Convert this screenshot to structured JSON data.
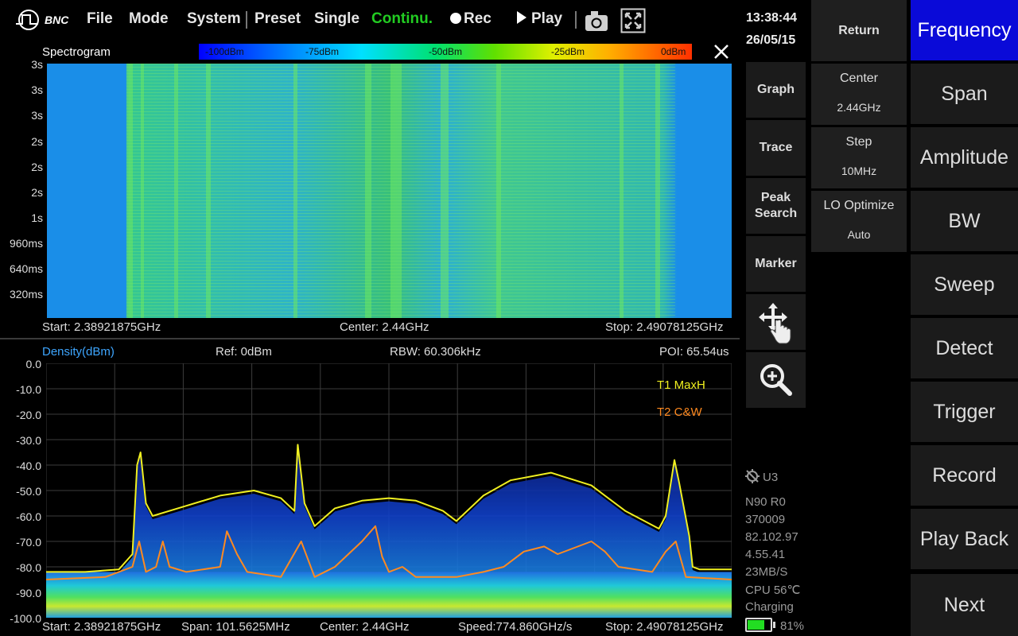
{
  "topbar": {
    "logo_text": "BNC",
    "menu": [
      "File",
      "Mode",
      "System",
      "Preset",
      "Single",
      "Continu.",
      "Rec",
      "Play"
    ],
    "active_color": "#22cc22"
  },
  "spectrogram": {
    "title": "Spectrogram",
    "colorbar_labels": [
      "-100dBm",
      "-75dBm",
      "-50dBm",
      "-25dBm",
      "0dBm"
    ],
    "time_ticks": [
      "3s",
      "3s",
      "3s",
      "2s",
      "2s",
      "2s",
      "1s",
      "960ms",
      "640ms",
      "320ms"
    ],
    "start": "Start: 2.38921875GHz",
    "center": "Center: 2.44GHz",
    "stop": "Stop: 2.49078125GHz"
  },
  "chart_data": {
    "type": "line",
    "title": "Density(dBm)",
    "ylim": [
      -100,
      0
    ],
    "ytick_labels": [
      "0.0",
      "-10.0",
      "-20.0",
      "-30.0",
      "-40.0",
      "-50.0",
      "-60.0",
      "-70.0",
      "-80.0",
      "-90.0",
      "-100.0"
    ],
    "xlim": [
      2.38921875,
      2.49078125
    ],
    "x_unit": "GHz",
    "grid": true,
    "header": {
      "ref": "Ref: 0dBm",
      "rbw": "RBW: 60.306kHz",
      "poi": "POI: 65.54us"
    },
    "series": [
      {
        "name": "T1 MaxH",
        "color": "#f0f020",
        "x": [
          2.3892,
          2.395,
          2.4,
          2.402,
          2.4027,
          2.4032,
          2.404,
          2.405,
          2.41,
          2.415,
          2.42,
          2.424,
          2.426,
          2.4265,
          2.4275,
          2.429,
          2.432,
          2.436,
          2.44,
          2.444,
          2.448,
          2.45,
          2.454,
          2.458,
          2.464,
          2.47,
          2.475,
          2.48,
          2.481,
          2.4823,
          2.483,
          2.4845,
          2.485,
          2.486,
          2.4908
        ],
        "y": [
          -82,
          -82,
          -81,
          -75,
          -40,
          -35,
          -55,
          -60,
          -56,
          -52,
          -50,
          -53,
          -58,
          -32,
          -55,
          -64,
          -57,
          -54,
          -53,
          -54,
          -58,
          -62,
          -52,
          -46,
          -43,
          -48,
          -58,
          -65,
          -60,
          -38,
          -47,
          -68,
          -80,
          -81,
          -81
        ]
      },
      {
        "name": "T2 C&W",
        "color": "#ff8a20",
        "x": [
          2.3892,
          2.398,
          2.402,
          2.403,
          2.404,
          2.4055,
          2.4065,
          2.4075,
          2.41,
          2.415,
          2.416,
          2.4175,
          2.419,
          2.424,
          2.427,
          2.429,
          2.432,
          2.436,
          2.438,
          2.439,
          2.44,
          2.442,
          2.444,
          2.448,
          2.45,
          2.454,
          2.457,
          2.46,
          2.463,
          2.465,
          2.47,
          2.472,
          2.474,
          2.479,
          2.481,
          2.4825,
          2.484,
          2.4908
        ],
        "y": [
          -85,
          -84,
          -80,
          -70,
          -82,
          -80,
          -70,
          -80,
          -82,
          -80,
          -66,
          -75,
          -82,
          -84,
          -70,
          -84,
          -80,
          -70,
          -64,
          -76,
          -82,
          -80,
          -84,
          -84,
          -84,
          -82,
          -80,
          -74,
          -72,
          -75,
          -70,
          -74,
          -80,
          -82,
          -74,
          -70,
          -84,
          -85
        ]
      }
    ],
    "footer": {
      "start": "Start: 2.38921875GHz",
      "span": "Span: 101.5625MHz",
      "center": "Center: 2.44GHz",
      "speed": "Speed:774.860GHz/s",
      "stop": "Stop: 2.49078125GHz"
    }
  },
  "clock": {
    "time": "13:38:44",
    "date": "26/05/15"
  },
  "side_buttons": [
    "Graph",
    "Trace",
    "Peak Search",
    "Marker"
  ],
  "params": {
    "return_label": "Return",
    "items": [
      {
        "label": "Center",
        "value": "2.44GHz"
      },
      {
        "label": "Step",
        "value": "10MHz"
      },
      {
        "label": "LO Optimize",
        "value": "Auto"
      }
    ]
  },
  "softkeys": [
    "Frequency",
    "Span",
    "Amplitude",
    "BW",
    "Sweep",
    "Detect",
    "Trigger",
    "Record",
    "Play Back",
    "Next"
  ],
  "active_color": "#0a0ad8",
  "system_info": {
    "lock": "U3",
    "lines": [
      "N90 R0",
      "370009",
      "82.102.97",
      "4.55.41",
      "23MB/S",
      "CPU  56℃",
      "Charging"
    ],
    "battery": "81%",
    "battery_level": 0.81
  }
}
